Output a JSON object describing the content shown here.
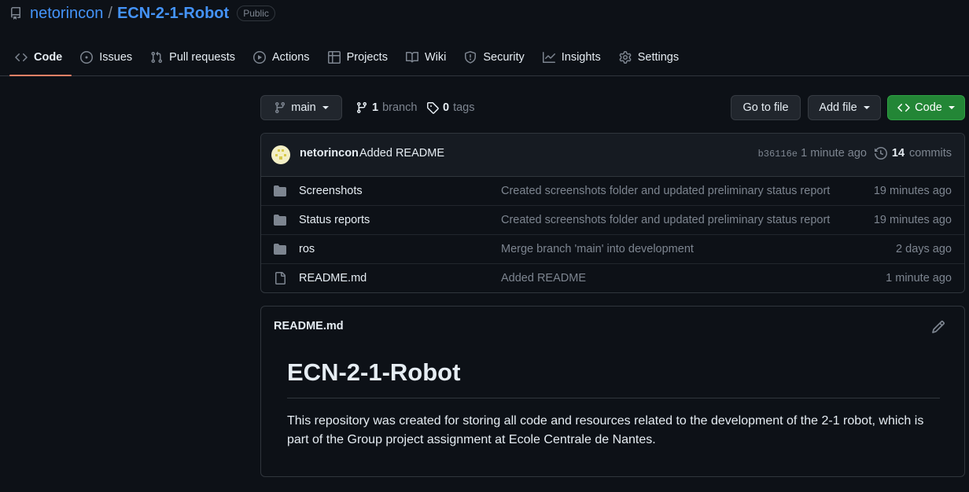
{
  "repo": {
    "owner": "netorincon",
    "separator": "/",
    "name": "ECN-2-1-Robot",
    "visibility": "Public"
  },
  "tabs": [
    {
      "label": "Code",
      "icon": "code-icon"
    },
    {
      "label": "Issues",
      "icon": "issue-icon"
    },
    {
      "label": "Pull requests",
      "icon": "pull-request-icon"
    },
    {
      "label": "Actions",
      "icon": "play-icon"
    },
    {
      "label": "Projects",
      "icon": "table-icon"
    },
    {
      "label": "Wiki",
      "icon": "book-icon"
    },
    {
      "label": "Security",
      "icon": "shield-icon"
    },
    {
      "label": "Insights",
      "icon": "graph-icon"
    },
    {
      "label": "Settings",
      "icon": "gear-icon"
    }
  ],
  "toolbar": {
    "branch_select": "main",
    "branch_count": "1",
    "branch_word": "branch",
    "tag_count": "0",
    "tag_word": "tags",
    "go_to_file": "Go to file",
    "add_file": "Add file",
    "code": "Code"
  },
  "commit": {
    "author": "netorincon",
    "message": "Added README",
    "sha": "b36116e",
    "time": "1 minute ago",
    "commit_count": "14",
    "commit_word": "commits"
  },
  "files": [
    {
      "name": "Screenshots",
      "type": "folder",
      "message": "Created screenshots folder and updated preliminary status report",
      "time": "19 minutes ago"
    },
    {
      "name": "Status reports",
      "type": "folder",
      "message": "Created screenshots folder and updated preliminary status report",
      "time": "19 minutes ago"
    },
    {
      "name": "ros",
      "type": "folder",
      "message": "Merge branch 'main' into development",
      "time": "2 days ago"
    },
    {
      "name": "README.md",
      "type": "file",
      "message": "Added README",
      "time": "1 minute ago"
    }
  ],
  "readme": {
    "filename": "README.md",
    "heading": "ECN-2-1-Robot",
    "body": "This repository was created for storing all code and resources related to the development of the 2-1 robot, which is part of the Group project assignment at Ecole Centrale de Nantes."
  },
  "colors": {
    "background": "#0d1117",
    "link": "#4493f8",
    "accent_underline": "#f78166",
    "primary_button": "#238636",
    "muted_text": "#7d8590"
  }
}
